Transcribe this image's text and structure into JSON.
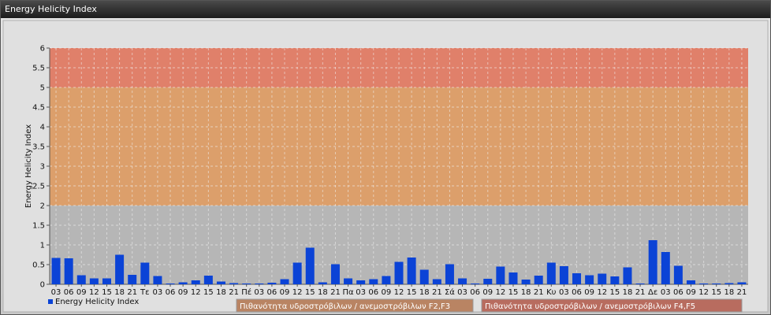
{
  "window": {
    "title": "Energy Helicity Index"
  },
  "legend": {
    "series_label": "Energy Helicity Index",
    "band_f2f3_label": "Πιθανότητα υδροστρόβιλων / ανεμοστρόβιλων F2,F3",
    "band_f4f5_label": "Πιθανότητα υδροστρόβιλων / ανεμοστρόβιλων F4,F5"
  },
  "colors": {
    "bar": "#0b43d6",
    "band_low": "#b6b6b6",
    "band_mid": "#dc9f6b",
    "band_high": "#e0806a",
    "legend_mid": "#b98463",
    "legend_high": "#b86c5f"
  },
  "chart_data": {
    "type": "bar",
    "ylabel": "Energy Helicity Index",
    "ylim": [
      0,
      6
    ],
    "yticks": [
      "0",
      "0.5",
      "1",
      "1.5",
      "2",
      "2.5",
      "3",
      "3.5",
      "4",
      "4.5",
      "5",
      "5.5",
      "6"
    ],
    "bands": [
      {
        "from": 2,
        "to": 5,
        "color": "mid"
      },
      {
        "from": 5,
        "to": 6,
        "color": "high"
      }
    ],
    "categories": [
      "03",
      "06",
      "09",
      "12",
      "15",
      "18",
      "21",
      "Τε",
      "03",
      "06",
      "09",
      "12",
      "15",
      "18",
      "21",
      "Πέ",
      "03",
      "06",
      "09",
      "12",
      "15",
      "18",
      "21",
      "Πα",
      "03",
      "06",
      "09",
      "12",
      "15",
      "18",
      "21",
      "Σά",
      "03",
      "06",
      "09",
      "12",
      "15",
      "18",
      "21",
      "Κυ",
      "03",
      "06",
      "09",
      "12",
      "15",
      "18",
      "21",
      "Δε",
      "03",
      "06",
      "09",
      "12",
      "15",
      "18",
      "21"
    ],
    "values": [
      0.67,
      0.66,
      0.23,
      0.15,
      0.15,
      0.75,
      0.24,
      0.55,
      0.21,
      0.02,
      0.05,
      0.1,
      0.22,
      0.07,
      0.03,
      0.02,
      0.02,
      0.04,
      0.13,
      0.55,
      0.93,
      0.05,
      0.51,
      0.15,
      0.1,
      0.13,
      0.21,
      0.57,
      0.68,
      0.37,
      0.13,
      0.51,
      0.15,
      0.02,
      0.14,
      0.45,
      0.3,
      0.12,
      0.22,
      0.55,
      0.46,
      0.28,
      0.23,
      0.27,
      0.2,
      0.43,
      0.02,
      1.12,
      0.82,
      0.47,
      0.1,
      0.02,
      0.02,
      0.03,
      0.05
    ]
  }
}
